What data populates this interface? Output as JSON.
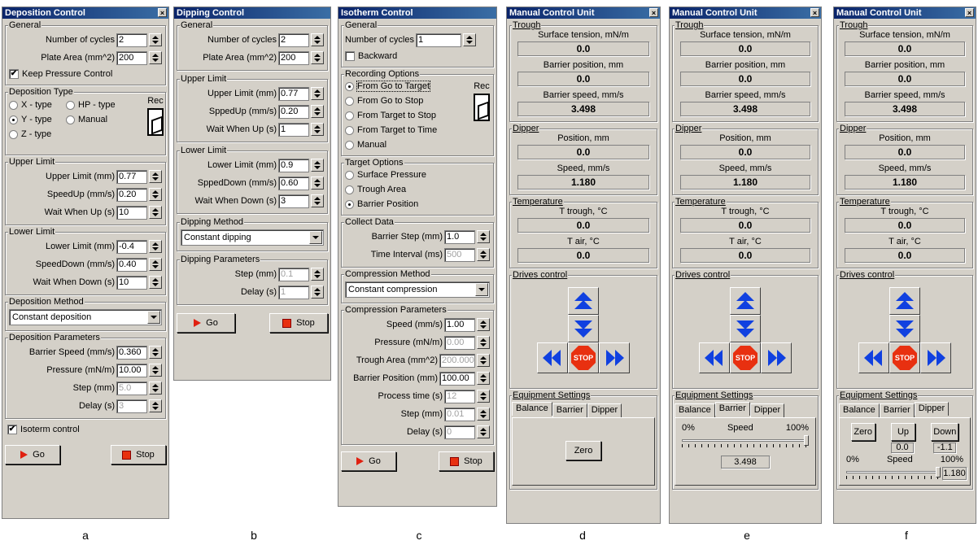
{
  "panels": {
    "a": {
      "title": "Deposition Control",
      "general": {
        "title": "General",
        "cycles_label": "Number of cycles",
        "cycles": "2",
        "area_label": "Plate Area (mm^2)",
        "area": "200",
        "keep_label": "Keep Pressure Control",
        "keep_checked": "✔"
      },
      "deptype": {
        "title": "Deposition Type",
        "x": "X - type",
        "hp": "HP - type",
        "y": "Y - type",
        "manual": "Manual",
        "z": "Z - type",
        "rec": "Rec"
      },
      "upper": {
        "title": "Upper Limit",
        "limit_label": "Upper Limit (mm)",
        "limit": "0.77",
        "speed_label": "SpeedUp (mm/s)",
        "speed": "0.20",
        "wait_label": "Wait When Up (s)",
        "wait": "10"
      },
      "lower": {
        "title": "Lower Limit",
        "limit_label": "Lower Limit (mm)",
        "limit": "-0.4",
        "speed_label": "SpeedDown (mm/s)",
        "speed": "0.40",
        "wait_label": "Wait When Down (s)",
        "wait": "10"
      },
      "method": {
        "title": "Deposition Method",
        "value": "Constant deposition"
      },
      "params": {
        "title": "Deposition Parameters",
        "bspeed_label": "Barrier Speed (mm/s)",
        "bspeed": "0.360",
        "pressure_label": "Pressure (mN/m)",
        "pressure": "10.00",
        "step_label": "Step (mm)",
        "step": "5.0",
        "delay_label": "Delay (s)",
        "delay": "3"
      },
      "iso_label": "Isoterm control",
      "iso_checked": "✔",
      "go": "Go",
      "stop": "Stop"
    },
    "b": {
      "title": "Dipping Control",
      "general": {
        "title": "General",
        "cycles_label": "Number of cycles",
        "cycles": "2",
        "area_label": "Plate Area (mm^2)",
        "area": "200"
      },
      "upper": {
        "title": "Upper Limit",
        "limit_label": "Upper Limit (mm)",
        "limit": "0.77",
        "speed_label": "SppedUp (mm/s)",
        "speed": "0.20",
        "wait_label": "Wait When Up (s)",
        "wait": "1"
      },
      "lower": {
        "title": "Lower Limit",
        "limit_label": "Lower Limit (mm)",
        "limit": "0.9",
        "speed_label": "SppedDown (mm/s)",
        "speed": "0.60",
        "wait_label": "Wait When Down (s)",
        "wait": "3"
      },
      "method": {
        "title": "Dipping Method",
        "value": "Constant dipping"
      },
      "params": {
        "title": "Dipping Parameters",
        "step_label": "Step (mm)",
        "step": "0.1",
        "delay_label": "Delay (s)",
        "delay": "1"
      },
      "go": "Go",
      "stop": "Stop"
    },
    "c": {
      "title": "Isotherm Control",
      "general": {
        "title": "General",
        "cycles_label": "Number of cycles",
        "cycles": "1",
        "backward": "Backward"
      },
      "rec_opts": {
        "title": "Recording Options",
        "o1": "From Go to Target",
        "o2": "From Go to Stop",
        "o3": "From Target to Stop",
        "o4": "From Target to Time",
        "o5": "Manual",
        "rec": "Rec"
      },
      "target": {
        "title": "Target Options",
        "o1": "Surface Pressure",
        "o2": "Trough Area",
        "o3": "Barrier Position"
      },
      "collect": {
        "title": "Collect Data",
        "step_label": "Barrier Step (mm)",
        "step": "1.0",
        "interval_label": "Time Interval (ms)",
        "interval": "500"
      },
      "method": {
        "title": "Compression Method",
        "value": "Constant compression"
      },
      "params": {
        "title": "Compression Parameters",
        "speed_label": "Speed (mm/s)",
        "speed": "1.00",
        "pressure_label": "Pressure (mN/m)",
        "pressure": "0.00",
        "area_label": "Trough Area (mm^2)",
        "area": "200.000",
        "pos_label": "Barrier Position (mm)",
        "pos": "100.00",
        "time_label": "Process time (s)",
        "time": "12",
        "step_label": "Step (mm)",
        "step": "0.01",
        "delay_label": "Delay (s)",
        "delay": "0"
      },
      "go": "Go",
      "stop": "Stop"
    },
    "mcu": {
      "title": "Manual Control Unit",
      "trough": "Trough",
      "st_label": "Surface tension, mN/m",
      "st": "0.0",
      "bp_label": "Barrier position, mm",
      "bp": "0.0",
      "bs_label": "Barrier speed, mm/s",
      "bs": "3.498",
      "dipper": "Dipper",
      "pos_label": "Position, mm",
      "pos": "0.0",
      "speed_label": "Speed, mm/s",
      "speed": "1.180",
      "temperature": "Temperature",
      "tt_label": "T trough, °C",
      "tt": "0.0",
      "ta_label": "T air, °C",
      "ta": "0.0",
      "drives": "Drives control",
      "stop": "STOP",
      "equip": "Equipment Settings",
      "tab_balance": "Balance",
      "tab_barrier": "Barrier",
      "tab_dipper": "Dipper",
      "zero": "Zero",
      "pct0": "0%",
      "pct_speed": "Speed",
      "pct100": "100%",
      "barrier_val": "3.498",
      "barrier_slider_level": 1.0,
      "up": "Up",
      "down": "Down",
      "up_val": "0.0",
      "down_val": "-1.1",
      "dipper_val": "1.180",
      "dipper_slider_level": 1.0
    }
  },
  "letters": [
    "a",
    "b",
    "c",
    "d",
    "e",
    "f"
  ]
}
